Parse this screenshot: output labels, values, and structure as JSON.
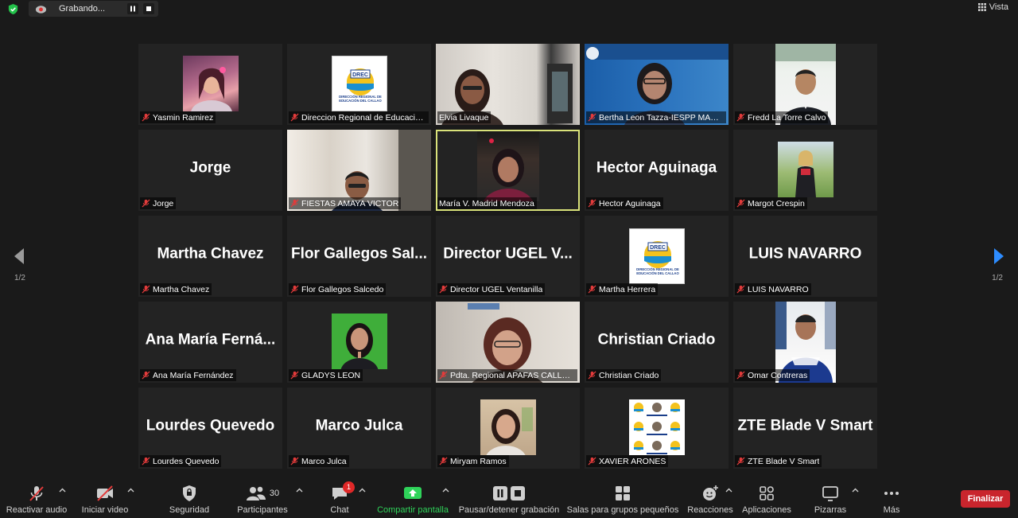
{
  "topbar": {
    "recording_label": "Grabando...",
    "view_label": "Vista"
  },
  "pagination": {
    "left": "1/2",
    "right": "1/2"
  },
  "tiles": [
    {
      "name": "Yasmin Ramirez"
    },
    {
      "name": "Direccion Regional de Educación..."
    },
    {
      "name": "Elvia Livaque"
    },
    {
      "name": "Bertha Leon Tazza-IESPP MARIA ..."
    },
    {
      "name": "Fredd La Torre Calvo"
    },
    {
      "name": "Jorge",
      "display": "Jorge"
    },
    {
      "name": "FIESTAS AMAYA VICTOR"
    },
    {
      "name": "María V. Madrid Mendoza"
    },
    {
      "name": "Hector Aguinaga",
      "display": "Hector Aguinaga"
    },
    {
      "name": "Margot Crespin"
    },
    {
      "name": "Martha Chavez",
      "display": "Martha Chavez"
    },
    {
      "name": "Flor Gallegos Salcedo",
      "display": "Flor Gallegos Sal..."
    },
    {
      "name": "Director UGEL Ventanilla",
      "display": "Director UGEL V..."
    },
    {
      "name": "Martha Herrera"
    },
    {
      "name": "LUIS NAVARRO",
      "display": "LUIS NAVARRO"
    },
    {
      "name": "Ana María Fernández",
      "display": "Ana María Ferná..."
    },
    {
      "name": "GLADYS LEON"
    },
    {
      "name": "Pdta. Regional APAFAS CALLAO ..."
    },
    {
      "name": "Christian Criado",
      "display": "Christian Criado"
    },
    {
      "name": "Omar Contreras"
    },
    {
      "name": "Lourdes Quevedo",
      "display": "Lourdes Quevedo"
    },
    {
      "name": "Marco Julca",
      "display": "Marco Julca"
    },
    {
      "name": "Miryam Ramos"
    },
    {
      "name": "XAVIER ARONES"
    },
    {
      "name": "ZTE Blade V Smart",
      "display": "ZTE Blade V Smart"
    }
  ],
  "drec_logo": {
    "line1": "DREC",
    "line2": "DIRECCIÓN REGIONAL DE",
    "line3": "EDUCACIÓN DEL CALLAO"
  },
  "toolbar": {
    "unmute": "Reactivar audio",
    "start_video": "Iniciar video",
    "security": "Seguridad",
    "participants": "Participantes",
    "participants_count": "30",
    "chat": "Chat",
    "chat_badge": "1",
    "share": "Compartir pantalla",
    "pause_rec": "Pausar/detener grabación",
    "breakout": "Salas para grupos pequeños",
    "reactions": "Reacciones",
    "apps": "Aplicaciones",
    "whiteboards": "Pizarras",
    "more": "Más",
    "end": "Finalizar"
  },
  "colors": {
    "accent_green": "#2fd35a",
    "end_red": "#c9252d",
    "active_speaker": "#d9e27a",
    "muted_red": "#e23b3b"
  }
}
